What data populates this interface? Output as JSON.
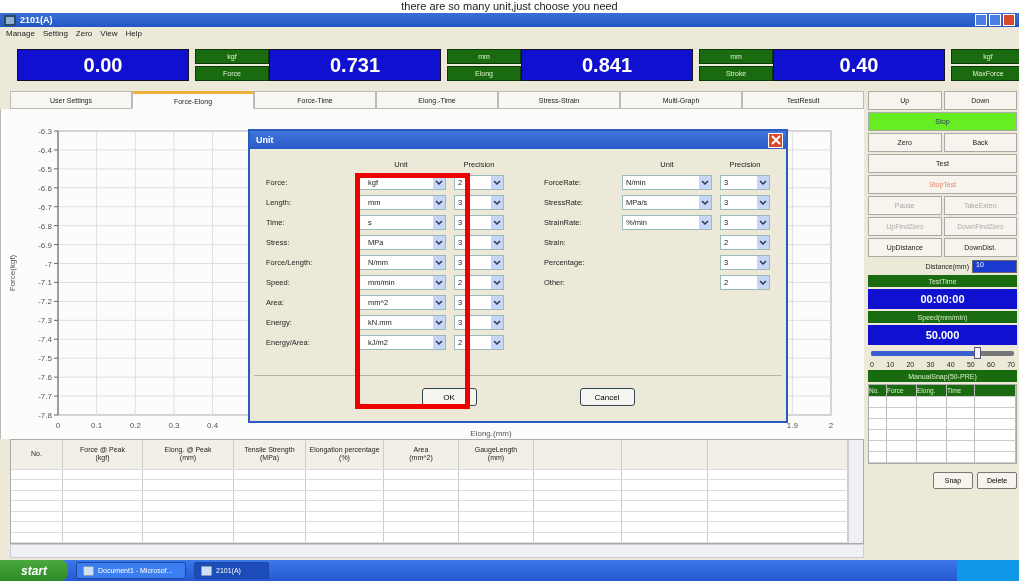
{
  "caption": "there are so many unit,just choose you need",
  "window": {
    "title": "2101(A)"
  },
  "menu": [
    "Manage",
    "Setting",
    "Zero",
    "View",
    "Help"
  ],
  "displays": [
    {
      "value": "0.00",
      "unit": "kgf",
      "name": "Force"
    },
    {
      "value": "0.731",
      "unit": "mm",
      "name": "Elong"
    },
    {
      "value": "0.841",
      "unit": "mm",
      "name": "Stroke"
    },
    {
      "value": "0.40",
      "unit": "kgf",
      "name": "MaxForce"
    }
  ],
  "tabs": [
    {
      "label": "User Settings",
      "selected": false
    },
    {
      "label": "Force-Elong",
      "selected": true
    },
    {
      "label": "Force-Time",
      "selected": false
    },
    {
      "label": "Elong.-Time",
      "selected": false
    },
    {
      "label": "Stress-Strain",
      "selected": false
    },
    {
      "label": "Multi-Graph",
      "selected": false
    },
    {
      "label": "TestResult",
      "selected": false
    }
  ],
  "chart": {
    "chart_data": {
      "type": "line",
      "grid": true,
      "xlabel": "Elong.(mm)",
      "ylabel": "Force(kgf)",
      "xlim": [
        0,
        2
      ],
      "ylim": [
        -7.8,
        -6.3
      ],
      "xticks": [
        0,
        0.1,
        0.2,
        0.3,
        0.4,
        1.9,
        2
      ],
      "yticks": [
        -6.3,
        -6.4,
        -6.5,
        -6.6,
        -6.7,
        -6.8,
        -6.9,
        {
          "value": -7,
          "label": "-7"
        },
        -7.1,
        -7.2,
        -7.3,
        -7.4,
        -7.5,
        -7.6,
        -7.7,
        -7.8
      ]
    }
  },
  "dialog": {
    "title": "Unit",
    "left_headers": [
      "Unit",
      "Precision"
    ],
    "left_rows": [
      {
        "label": "Force:",
        "unit": "kgf",
        "precision": "2"
      },
      {
        "label": "Length:",
        "unit": "mm",
        "precision": "3"
      },
      {
        "label": "Time:",
        "unit": "s",
        "precision": "3"
      },
      {
        "label": "Stress:",
        "unit": "MPa",
        "precision": "3"
      },
      {
        "label": "Force/Length:",
        "unit": "N/mm",
        "precision": "3"
      },
      {
        "label": "Speed:",
        "unit": "mm/min",
        "precision": "2"
      },
      {
        "label": "Area:",
        "unit": "mm^2",
        "precision": "3"
      },
      {
        "label": "Energy:",
        "unit": "kN.mm",
        "precision": "3"
      },
      {
        "label": "Energy/Area:",
        "unit": "kJ/m2",
        "precision": "2"
      }
    ],
    "right_headers": [
      "Unit",
      "Precision"
    ],
    "right_rows": [
      {
        "label": "ForceRate:",
        "unit": "N/min",
        "precision": "3"
      },
      {
        "label": "StressRate:",
        "unit": "MPa/s",
        "precision": "3"
      },
      {
        "label": "StrainRate:",
        "unit": "%/min",
        "precision": "3"
      },
      {
        "label": "Strain:",
        "precision": "2"
      },
      {
        "label": "Percentage:",
        "precision": "3"
      },
      {
        "label": "Other:",
        "precision": "2"
      }
    ],
    "buttons": [
      "OK",
      "Cancel"
    ]
  },
  "results": {
    "columns": [
      {
        "label": "No."
      },
      {
        "label": "Force @ Peak",
        "unit": "(kgf)"
      },
      {
        "label": "Elong. @ Peak",
        "unit": "(mm)"
      },
      {
        "label": "Tensile Strength",
        "unit": "(MPa)"
      },
      {
        "label": "Elongation percentage",
        "unit": "(%)"
      },
      {
        "label": "Area",
        "unit": "(mm^2)"
      },
      {
        "label": "GaugeLength",
        "unit": "(mm)"
      },
      {},
      {},
      {}
    ]
  },
  "controls": [
    {
      "label": "Up",
      "kind": "half",
      "disabled": false
    },
    {
      "label": "Down",
      "kind": "half",
      "disabled": false
    },
    {
      "label": "Stop",
      "kind": "stop",
      "disabled": false
    },
    {
      "label": "Zero",
      "kind": "half",
      "disabled": false
    },
    {
      "label": "Back",
      "kind": "half",
      "disabled": false
    },
    {
      "label": "Test",
      "kind": "full",
      "disabled": false
    },
    {
      "label": "StopTest",
      "kind": "full",
      "disabled": true
    },
    {
      "label": "Pause",
      "kind": "half",
      "disabled": true
    },
    {
      "label": "TakeExten",
      "kind": "half",
      "disabled": true
    },
    {
      "label": "UpFindZero",
      "kind": "half",
      "disabled": true
    },
    {
      "label": "DownFindZero",
      "kind": "half",
      "disabled": true
    },
    {
      "label": "UpDistance",
      "kind": "half",
      "disabled": false
    },
    {
      "label": "DownDist.",
      "kind": "half",
      "disabled": false
    }
  ],
  "distance": {
    "label": "Distance(mm)",
    "value": "10"
  },
  "test_time": {
    "label": "TestTime",
    "value": "00:00:00"
  },
  "speed": {
    "label": "Speed(mm/min)",
    "value": "50.000",
    "level": 0.75,
    "ticks": [
      "0",
      "10",
      "20",
      "30",
      "40",
      "50",
      "60",
      "70"
    ]
  },
  "manual_snap": {
    "label": "ManualSnap(50-PRE)",
    "columns": [
      "No.",
      "Force",
      "Elong.",
      "Time"
    ],
    "buttons": [
      "Snap",
      "Delete"
    ]
  },
  "taskbar": {
    "start": "start",
    "items": [
      {
        "label": "Document1 - Microsof...",
        "selected": false
      },
      {
        "label": "2101(A)",
        "selected": true
      }
    ]
  }
}
